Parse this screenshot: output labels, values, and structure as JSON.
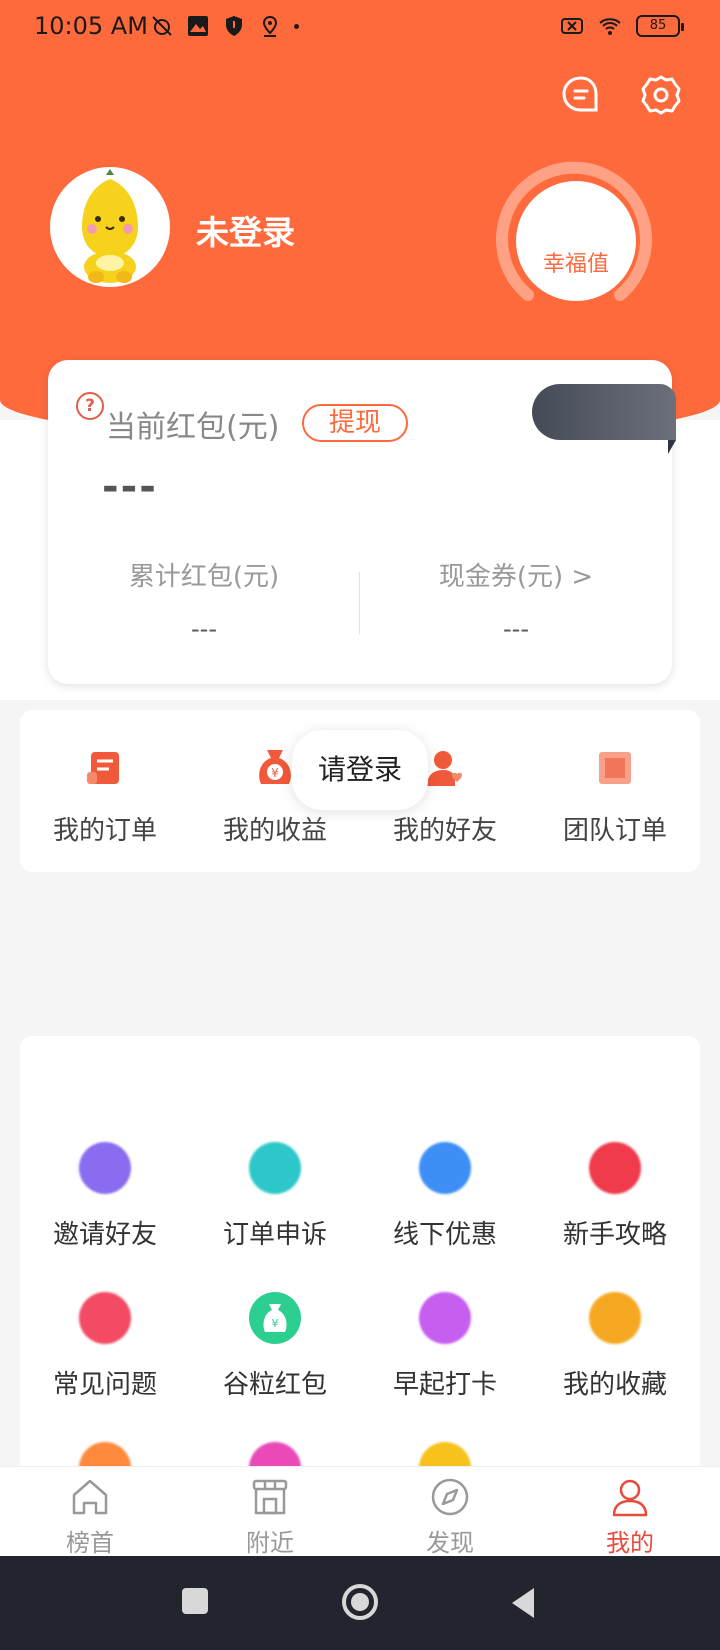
{
  "status_bar": {
    "time": "10:05 AM",
    "battery": "85"
  },
  "header": {
    "username": "未登录",
    "happiness_label": "幸福值"
  },
  "red_packet": {
    "help_symbol": "?",
    "title": "当前红包(元)",
    "withdraw": "提现",
    "current_value": "---",
    "total_label": "累计红包(元)",
    "total_value": "---",
    "coupon_label": "现金券(元)  >",
    "coupon_value": "---"
  },
  "quick_menu": [
    {
      "label": "我的订单",
      "icon": "order-icon"
    },
    {
      "label": "我的收益",
      "icon": "money-bag-icon"
    },
    {
      "label": "我的好友",
      "icon": "friend-icon"
    },
    {
      "label": "团队订单",
      "icon": "team-order-icon"
    }
  ],
  "toast": {
    "text": "请登录"
  },
  "services": [
    {
      "label": "邀请好友",
      "icon": "invite-icon",
      "color": "#8a6cf0"
    },
    {
      "label": "订单申诉",
      "icon": "appeal-icon",
      "color": "#2ec7c9"
    },
    {
      "label": "线下优惠",
      "icon": "offline-icon",
      "color": "#3d8ff5"
    },
    {
      "label": "新手攻略",
      "icon": "guide-icon",
      "color": "#ef3b4b"
    },
    {
      "label": "常见问题",
      "icon": "faq-icon",
      "color": "#f24b63"
    },
    {
      "label": "谷粒红包",
      "icon": "grain-redpacket-icon",
      "color": "#2ccf8f"
    },
    {
      "label": "早起打卡",
      "icon": "checkin-icon",
      "color": "#c65ef0"
    },
    {
      "label": "我的收藏",
      "icon": "favorite-icon",
      "color": "#f7a823"
    }
  ],
  "partial_row_colors": [
    "#ff8a3d",
    "#e94ab8",
    "#f7c21b"
  ],
  "bottom_nav": [
    {
      "label": "榜首",
      "icon": "home-icon"
    },
    {
      "label": "附近",
      "icon": "store-icon"
    },
    {
      "label": "发现",
      "icon": "compass-icon"
    },
    {
      "label": "我的",
      "icon": "user-icon"
    }
  ],
  "colors": {
    "brand": "#ff6a3d",
    "active": "#e84a3b"
  }
}
